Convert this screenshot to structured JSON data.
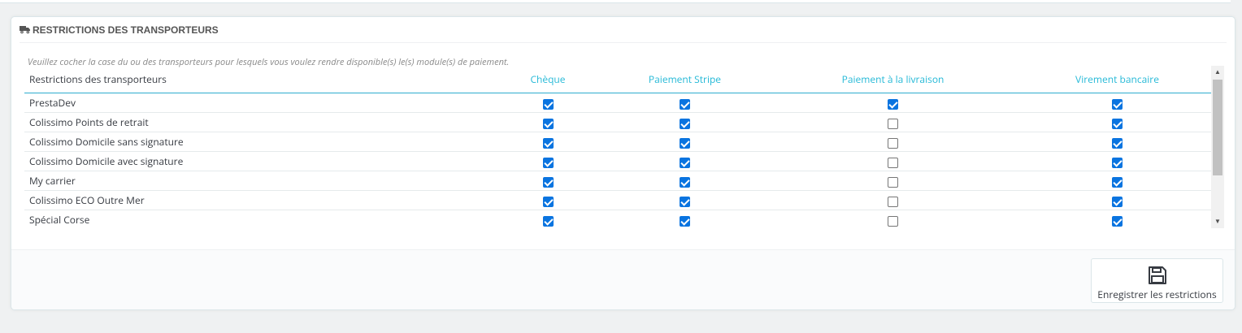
{
  "panel": {
    "title": "RESTRICTIONS DES TRANSPORTEURS",
    "title_icon": "truck-icon",
    "help": "Veuillez cocher la case du ou des transporteurs pour lesquels vous voulez rendre disponible(s) le(s) module(s) de paiement."
  },
  "table": {
    "first_header": "Restrictions des transporteurs",
    "payment_modules": [
      "Chèque",
      "Paiement Stripe",
      "Paiement à la livraison",
      "Virement bancaire"
    ],
    "rows": [
      {
        "carrier": "PrestaDev",
        "checks": [
          true,
          true,
          true,
          true
        ]
      },
      {
        "carrier": "Colissimo Points de retrait",
        "checks": [
          true,
          true,
          false,
          true
        ]
      },
      {
        "carrier": "Colissimo Domicile sans signature",
        "checks": [
          true,
          true,
          false,
          true
        ]
      },
      {
        "carrier": "Colissimo Domicile avec signature",
        "checks": [
          true,
          true,
          false,
          true
        ]
      },
      {
        "carrier": "My carrier",
        "checks": [
          true,
          true,
          false,
          true
        ]
      },
      {
        "carrier": "Colissimo ECO Outre Mer",
        "checks": [
          true,
          true,
          false,
          true
        ]
      },
      {
        "carrier": "Spécial Corse",
        "checks": [
          true,
          true,
          false,
          true
        ]
      }
    ]
  },
  "footer": {
    "save_label": "Enregistrer les restrictions",
    "save_icon": "save-floppy-icon"
  },
  "colors": {
    "accent": "#25b9d7",
    "checkbox": "#0a74e0",
    "background": "#eff1f2"
  }
}
